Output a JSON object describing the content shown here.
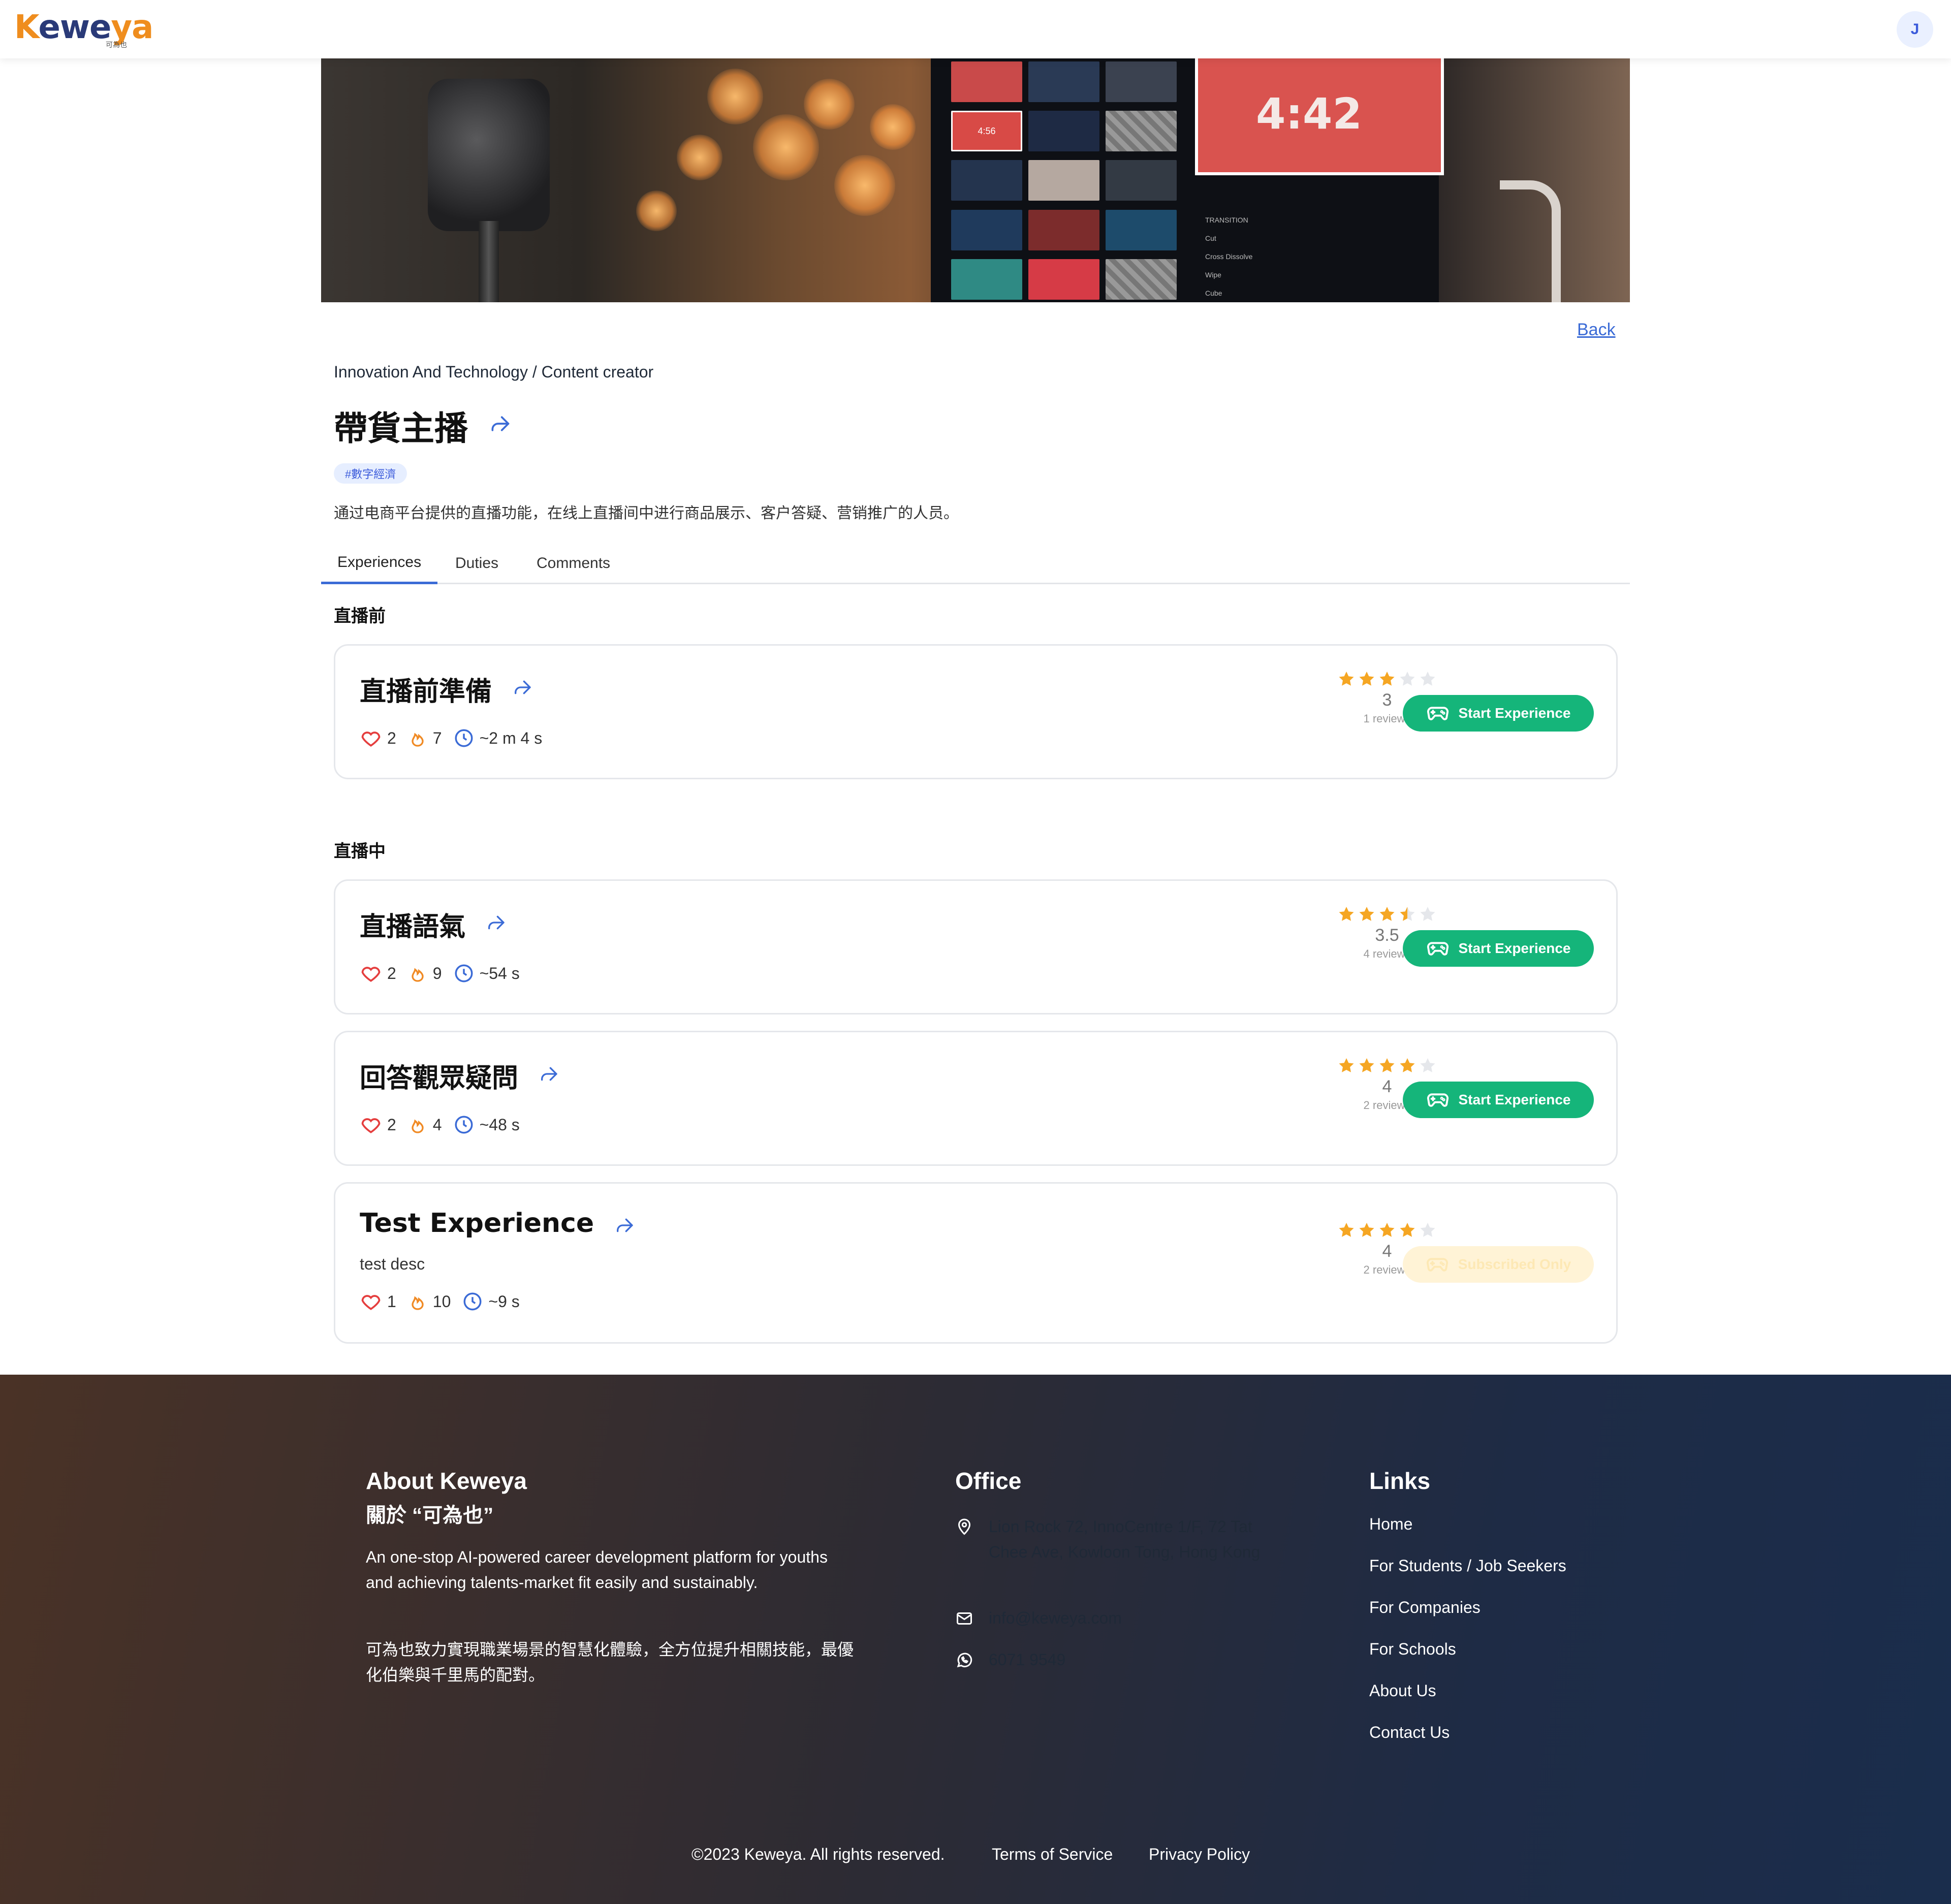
{
  "header": {
    "logo": {
      "k": "K",
      "ewe": "ewe",
      "ya": "ya",
      "sub": "可為也"
    },
    "avatar_initial": "J"
  },
  "banner": {
    "screen_time": "4:42",
    "thumb_time": "4:56",
    "menu_items": [
      "TRANSITION",
      "Cut",
      "Cross Dissolve",
      "Wipe",
      "Cube"
    ]
  },
  "nav": {
    "back": "Back"
  },
  "breadcrumb": "Innovation And Technology / Content creator",
  "title": "帶貨主播",
  "tag": "#數字經濟",
  "description": "通过电商平台提供的直播功能，在线上直播间中进行商品展示、客户答疑、营销推广的人员。",
  "tabs": [
    "Experiences",
    "Duties",
    "Comments"
  ],
  "sections": [
    {
      "title": "直播前",
      "cards": [
        {
          "title": "直播前準備",
          "desc": "",
          "likes": "2",
          "hot": "7",
          "time": "~2 m 4 s",
          "rating": 3,
          "rating_label": "3",
          "reviews": "1 reviews",
          "action": "Start Experience",
          "enabled": true
        }
      ]
    },
    {
      "title": "直播中",
      "cards": [
        {
          "title": "直播語氣",
          "desc": "",
          "likes": "2",
          "hot": "9",
          "time": "~54 s",
          "rating": 3.5,
          "rating_label": "3.5",
          "reviews": "4 reviews",
          "action": "Start Experience",
          "enabled": true
        },
        {
          "title": "回答觀眾疑問",
          "desc": "",
          "likes": "2",
          "hot": "4",
          "time": "~48 s",
          "rating": 4,
          "rating_label": "4",
          "reviews": "2 reviews",
          "action": "Start Experience",
          "enabled": true
        },
        {
          "title": "Test Experience",
          "desc": "test desc",
          "likes": "1",
          "hot": "10",
          "time": "~9 s",
          "rating": 4,
          "rating_label": "4",
          "reviews": "2 reviews",
          "action": "Subscribed Only",
          "enabled": false
        }
      ]
    }
  ],
  "colors": {
    "primary": "#3b6bd6",
    "start_button": "#15b57a",
    "star": "#f5a623",
    "heart": "#e53e3e",
    "fire": "#f08a24"
  },
  "footer": {
    "about": {
      "title": "About Keweya",
      "subtitle": "關於 “可為也”",
      "text_en": "An one-stop AI-powered career development platform for youths and achieving talents-market fit easily and sustainably.",
      "text_zh": "可為也致力實現職業場景的智慧化體驗，全方位提升相關技能，最優化伯樂與千里馬的配對。"
    },
    "office": {
      "title": "Office",
      "address": "Lion Rock 72, InnoCentre 1/F, 72 Tat Chee Ave, Kowloon Tong, Hong Kong",
      "email": "info@keweya.com",
      "phone": "6071 9549"
    },
    "links": {
      "title": "Links",
      "items": [
        "Home",
        "For Students / Job Seekers",
        "For Companies",
        "For Schools",
        "About Us",
        "Contact Us"
      ]
    },
    "copyright": "©2023 Keweya. All rights reserved.",
    "terms": "Terms of Service",
    "privacy": "Privacy Policy"
  }
}
